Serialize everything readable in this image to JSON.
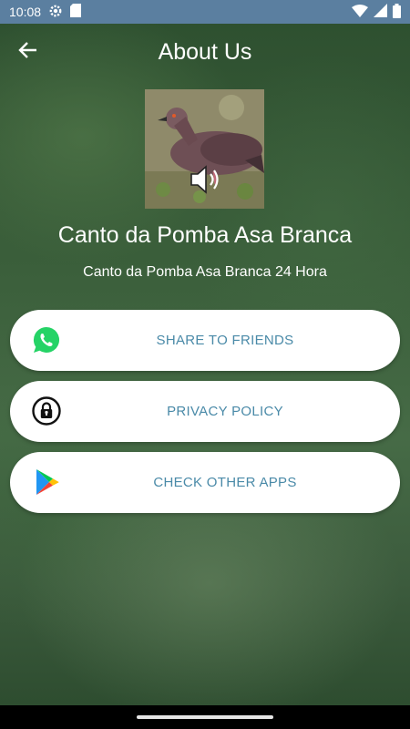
{
  "status_bar": {
    "time": "10:08",
    "icons": [
      "gear-icon",
      "sd-card-icon",
      "wifi-icon",
      "signal-icon",
      "battery-icon"
    ]
  },
  "app_bar": {
    "title": "About Us",
    "back_icon": "arrow-back-icon"
  },
  "app_info": {
    "name": "Canto da Pomba Asa Branca",
    "subtitle": "Canto da Pomba Asa Branca 24 Hora",
    "image_icon": "speaker-icon"
  },
  "actions": [
    {
      "label": "SHARE TO FRIENDS",
      "icon": "whatsapp-icon"
    },
    {
      "label": "PRIVACY POLICY",
      "icon": "lock-icon"
    },
    {
      "label": "CHECK OTHER APPS",
      "icon": "play-store-icon"
    }
  ],
  "colors": {
    "status_bar": "#5b7fa0",
    "button_text": "#4a8aa8",
    "button_bg": "#ffffff",
    "whatsapp": "#25d366"
  }
}
